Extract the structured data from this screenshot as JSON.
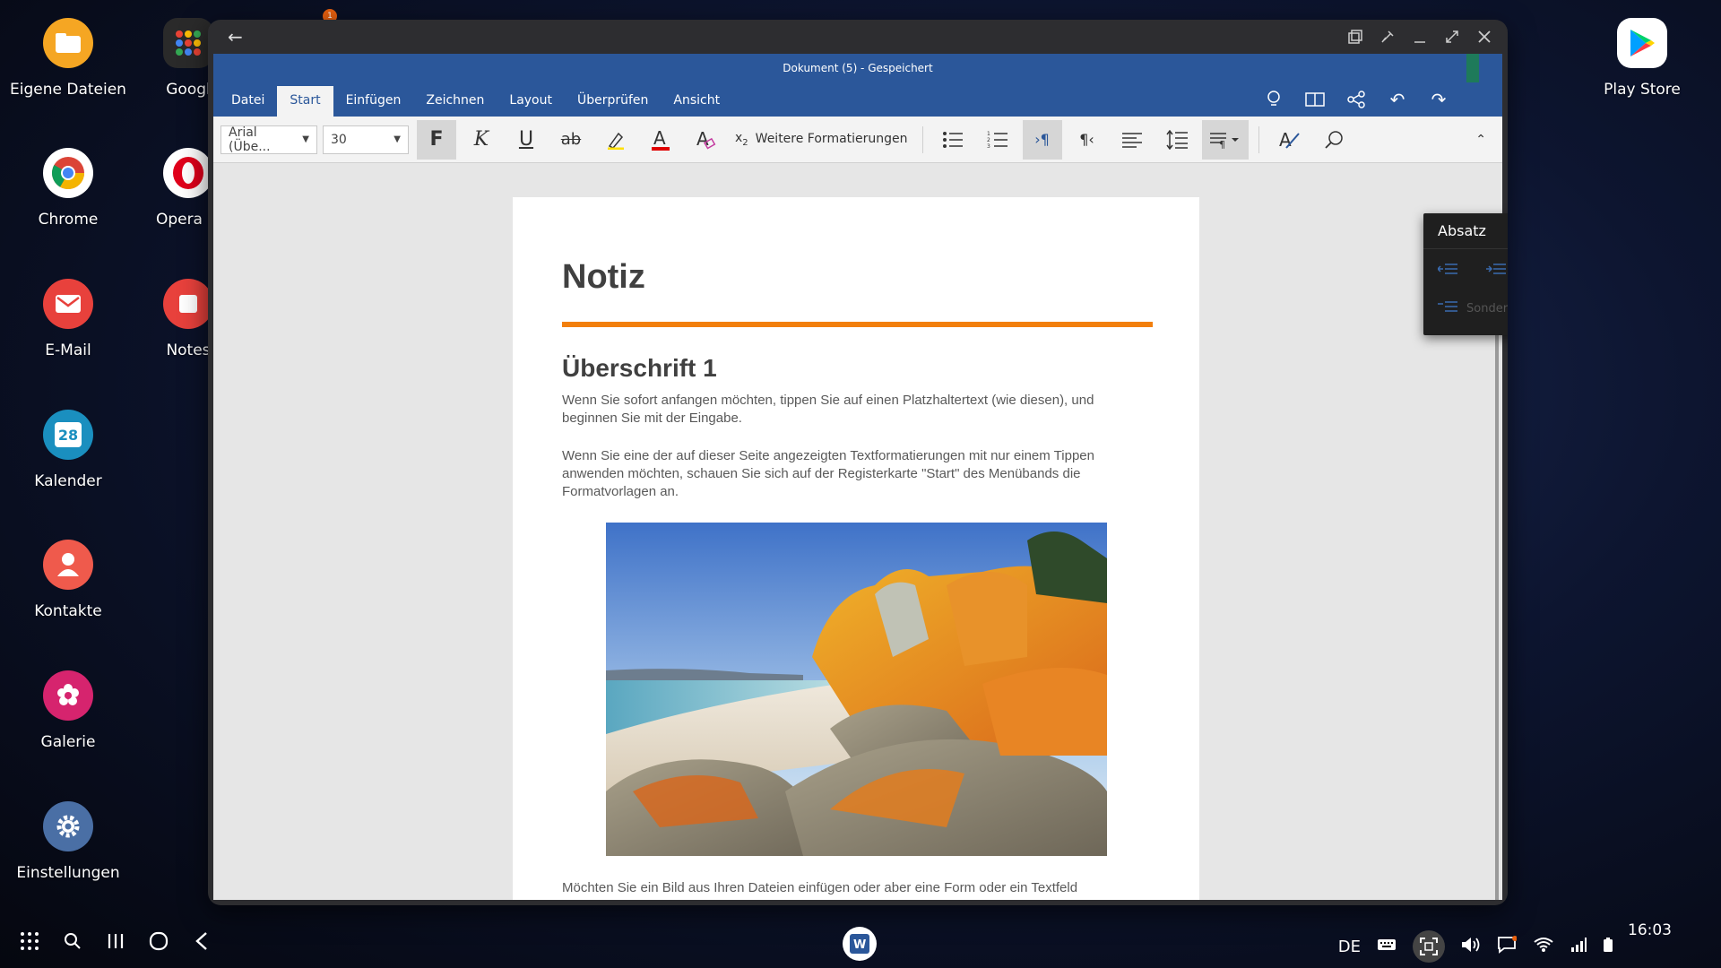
{
  "desktop": {
    "left_icons": [
      {
        "label": "Eigene Dateien",
        "icon": "folder-icon",
        "color": "#f5a623"
      },
      {
        "label": "Chrome",
        "icon": "chrome-icon",
        "color": "#ffffff"
      },
      {
        "label": "E-Mail",
        "icon": "mail-icon",
        "color": "#e8413c"
      },
      {
        "label": "Kalender",
        "icon": "calendar-icon",
        "color": "#1a8fbf",
        "day": "28"
      },
      {
        "label": "Kontakte",
        "icon": "contacts-icon",
        "color": "#ef5a4c"
      },
      {
        "label": "Galerie",
        "icon": "gallery-icon",
        "color": "#d6246e"
      },
      {
        "label": "Einstellungen",
        "icon": "settings-icon",
        "color": "#4a6fa5"
      }
    ],
    "second_col_icons": [
      {
        "label": "Googl",
        "icon": "google-folder-icon"
      },
      {
        "label": "Opera M",
        "icon": "opera-icon"
      },
      {
        "label": "Notes",
        "icon": "notes-icon"
      }
    ],
    "right_icons": [
      {
        "label": "Play Store",
        "icon": "play-store-icon"
      }
    ]
  },
  "window": {
    "doc_title": "Dokument (5) - Gespeichert",
    "tabs": [
      {
        "label": "Datei",
        "active": false
      },
      {
        "label": "Start",
        "active": true
      },
      {
        "label": "Einfügen",
        "active": false
      },
      {
        "label": "Zeichnen",
        "active": false
      },
      {
        "label": "Layout",
        "active": false
      },
      {
        "label": "Überprüfen",
        "active": false
      },
      {
        "label": "Ansicht",
        "active": false
      }
    ],
    "font_name": "Arial (Übe...",
    "font_size": "30",
    "more_formatting": "Weitere Formatierungen"
  },
  "document": {
    "title": "Notiz",
    "heading1": "Überschrift 1",
    "para1": "Wenn Sie sofort anfangen möchten, tippen Sie auf einen Platzhaltertext (wie diesen), und beginnen Sie mit der Eingabe.",
    "para2": "Wenn Sie eine der auf dieser Seite angezeigten Textformatierungen mit nur einem Tippen anwenden möchten, schauen Sie sich auf der Registerkarte \"Start\" des Menübands die Formatvorlagen an.",
    "para3": "Möchten Sie ein Bild aus Ihren Dateien einfügen oder aber eine Form oder ein Textfeld hinzufügen? Das geht ganz einfach! Tippen Sie auf der Registerkarte \"Einfügen\" des Menübands auf die gewünschte Option.",
    "accent_color": "#f27f0c"
  },
  "popup": {
    "title": "Absatz",
    "special_indent": "Sondereinzug"
  },
  "taskbar": {
    "language": "DE",
    "time": "16:03",
    "notification_count": "1"
  }
}
